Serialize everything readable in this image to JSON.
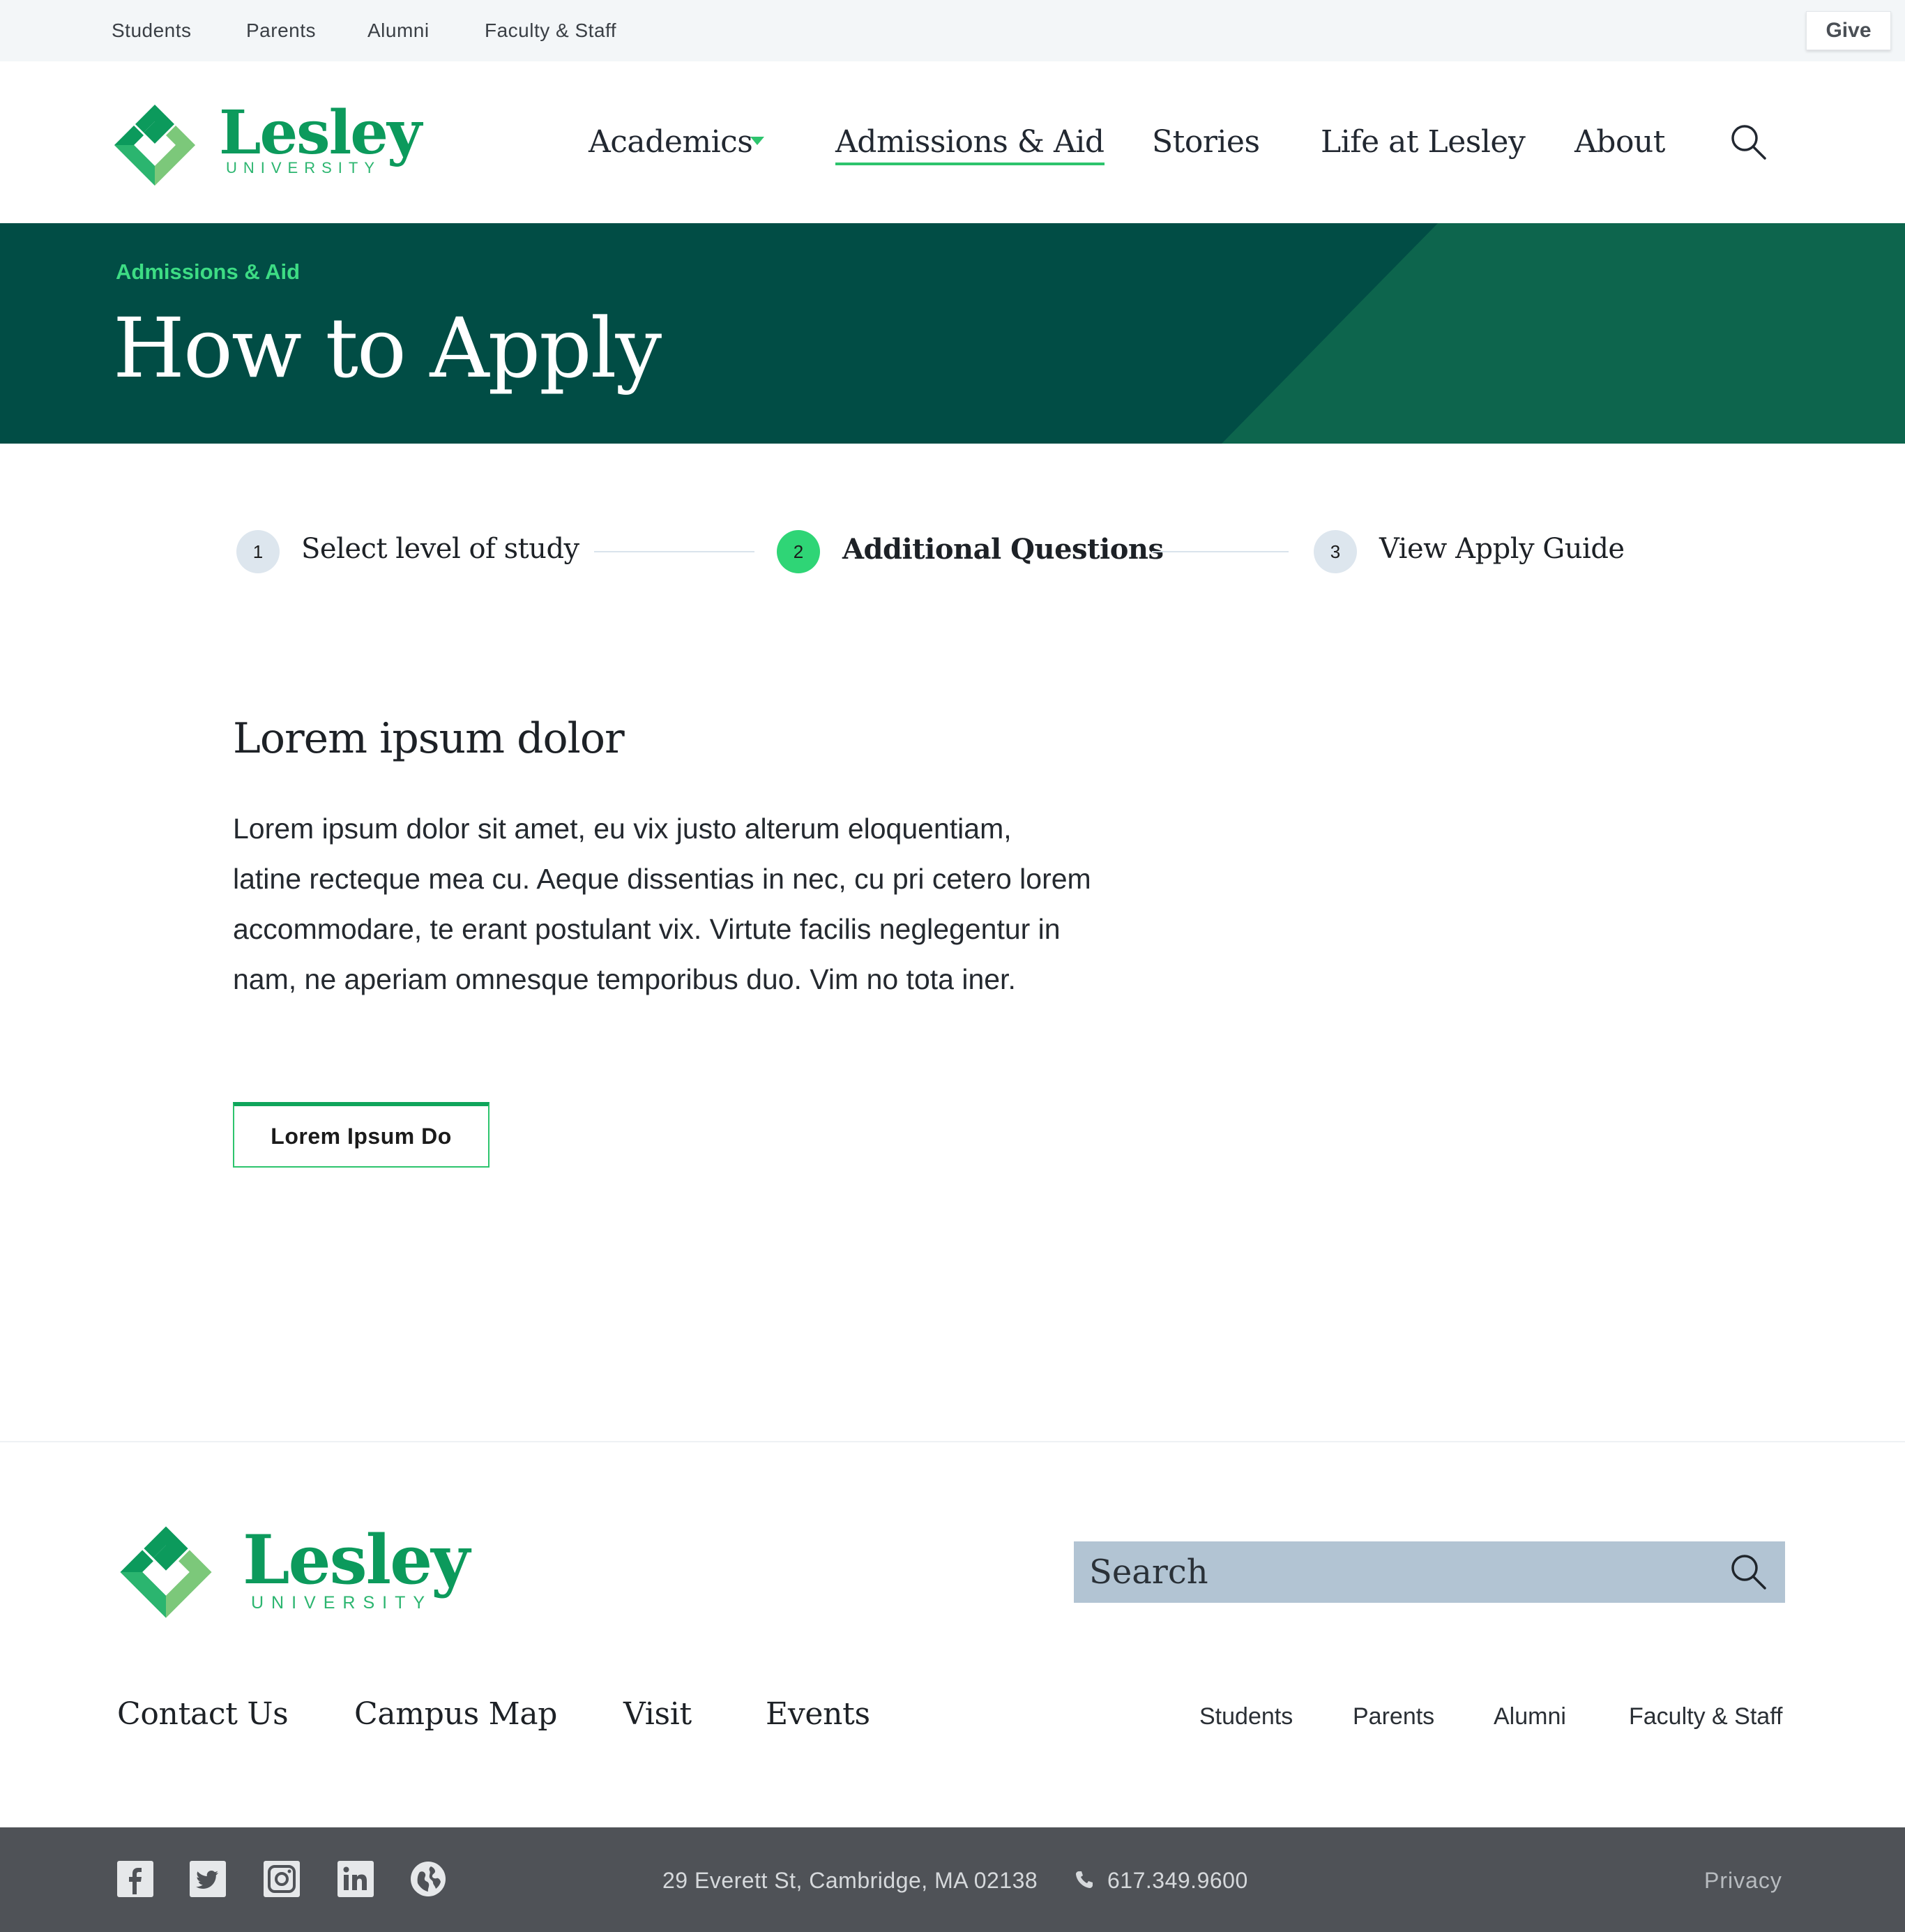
{
  "utility_nav": {
    "links": [
      "Students",
      "Parents",
      "Alumni",
      "Faculty & Staff"
    ],
    "give_label": "Give"
  },
  "brand": {
    "name": "Lesley",
    "subtitle": "UNIVERSITY",
    "colors": {
      "primary_green": "#0c9a5c",
      "light_green": "#7cc87a",
      "accent_green": "#2dc46d",
      "hero_teal": "#014d45"
    }
  },
  "main_nav": {
    "items": [
      "Academics",
      "Admissions & Aid",
      "Stories",
      "Life at Lesley",
      "About"
    ],
    "active": "Admissions & Aid",
    "search_icon": "search-icon"
  },
  "hero": {
    "eyebrow": "Admissions & Aid",
    "title": "How to Apply"
  },
  "stepper": {
    "steps": [
      {
        "number": "1",
        "label": "Select level of study",
        "state": "inactive"
      },
      {
        "number": "2",
        "label": "Additional Questions",
        "state": "active"
      },
      {
        "number": "3",
        "label": "View Apply Guide",
        "state": "inactive"
      }
    ]
  },
  "content": {
    "heading": "Lorem ipsum dolor",
    "body_lines": [
      "Lorem ipsum dolor sit amet, eu vix justo alterum eloquentiam,",
      "latine recteque mea cu. Aeque dissentias in nec, cu pri cetero lorem",
      "accommodare, te erant postulant vix. Virtute facilis neglegentur in",
      "nam, ne aperiam omnesque temporibus duo. Vim no tota iner."
    ],
    "button_label": "Lorem Ipsum Do"
  },
  "footer": {
    "search_placeholder": "Search",
    "links": [
      "Contact Us",
      "Campus Map",
      "Visit",
      "Events"
    ],
    "audience_links": [
      "Students",
      "Parents",
      "Alumni",
      "Faculty & Staff"
    ],
    "social_icons": [
      "facebook-icon",
      "twitter-icon",
      "instagram-icon",
      "linkedin-icon",
      "globe-icon"
    ],
    "address": "29 Everett St, Cambridge, MA 02138",
    "phone": "617.349.9600",
    "privacy": "Privacy"
  }
}
